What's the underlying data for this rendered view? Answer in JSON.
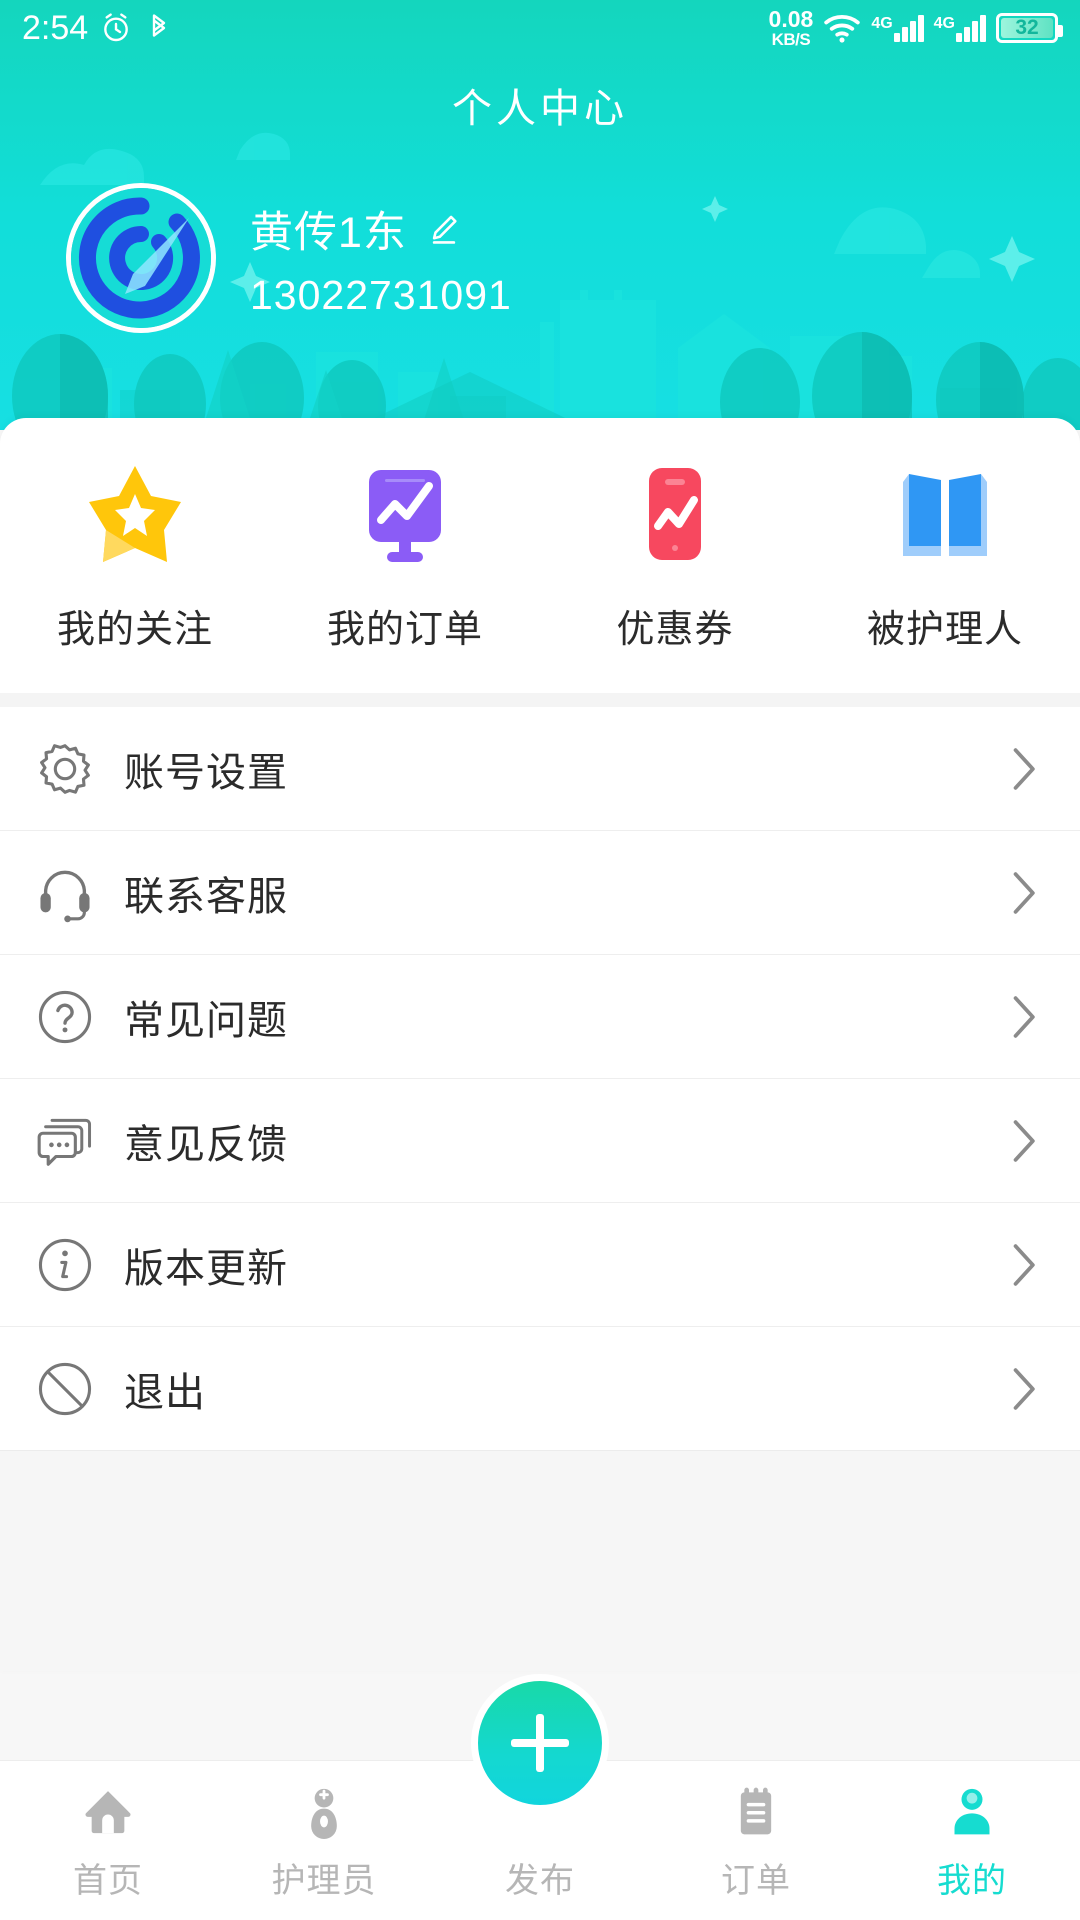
{
  "status_bar": {
    "time": "2:54",
    "alarm_icon": "alarm-clock-icon",
    "bluetooth_icon": "bluetooth-icon",
    "net_speed_value": "0.08",
    "net_speed_unit": "KB/S",
    "wifi_icon": "wifi-icon",
    "sim1_label": "4G",
    "sim2_label": "4G",
    "battery_percent": "32"
  },
  "header": {
    "title": "个人中心",
    "avatar_icon": "avatar-logo-icon",
    "user_name": "黄传1东",
    "edit_icon": "edit-pencil-icon",
    "phone": "13022731091",
    "bg_gradient_start": "#14d6bd",
    "bg_gradient_end": "#18dfe2"
  },
  "quick_actions": [
    {
      "label": "我的关注",
      "icon": "star-icon",
      "color": "#ffc60b"
    },
    {
      "label": "我的订单",
      "icon": "monitor-chart-icon",
      "color": "#8b5cf6"
    },
    {
      "label": "优惠券",
      "icon": "phone-chart-icon",
      "color": "#f7485f"
    },
    {
      "label": "被护理人",
      "icon": "open-book-icon",
      "color": "#2f97f4"
    }
  ],
  "menu_items": [
    {
      "label": "账号设置",
      "icon": "gear-icon",
      "chevron": "chevron-right-icon"
    },
    {
      "label": "联系客服",
      "icon": "headset-icon",
      "chevron": "chevron-right-icon"
    },
    {
      "label": "常见问题",
      "icon": "question-circle-icon",
      "chevron": "chevron-right-icon"
    },
    {
      "label": "意见反馈",
      "icon": "chat-bubble-icon",
      "chevron": "chevron-right-icon"
    },
    {
      "label": "版本更新",
      "icon": "info-circle-icon",
      "chevron": "chevron-right-icon"
    },
    {
      "label": "退出",
      "icon": "ban-circle-icon",
      "chevron": "chevron-right-icon"
    }
  ],
  "tab_bar": {
    "active_color": "#16dcd0",
    "inactive_color": "#b6b6b6",
    "items": [
      {
        "label": "首页",
        "icon": "home-icon",
        "active": false
      },
      {
        "label": "护理员",
        "icon": "nurse-icon",
        "active": false
      },
      {
        "label": "发布",
        "icon": "plus-fab-icon",
        "active": false
      },
      {
        "label": "订单",
        "icon": "clipboard-icon",
        "active": false
      },
      {
        "label": "我的",
        "icon": "person-icon",
        "active": true
      }
    ]
  }
}
